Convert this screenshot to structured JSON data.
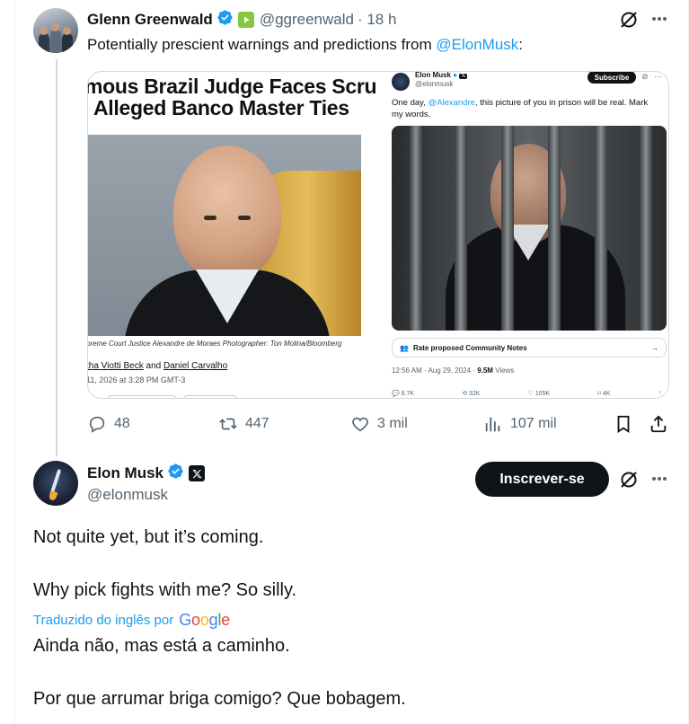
{
  "colors": {
    "accent": "#1d9bf0",
    "text": "#0f1419",
    "muted": "#536471",
    "subscribe_bg": "#0f1419"
  },
  "quoted_tweet": {
    "author": {
      "name": "Glenn Greenwald",
      "handle": "@ggreenwald",
      "time": "· 18 h",
      "verified": true,
      "badge_icon": "rumble-icon"
    },
    "text_before": "Potentially prescient warnings and predictions from ",
    "mention": "@ElonMusk",
    "text_after": ":",
    "media": {
      "article": {
        "headline_line1": "mous Brazil Judge Faces Scru",
        "headline_line2": "Alleged Banco Master Ties",
        "caption": "preme Court Justice Alexandre de Moraes Photographer: Ton Molina/Bloomberg",
        "byline_prefix": "tha Viotti Beck",
        "byline_and": " and ",
        "byline_author": "Daniel Carvalho",
        "date": "11, 2026 at 3:28 PM GMT-3"
      },
      "screenshot": {
        "name": "Elon Musk",
        "handle": "@elonmusk",
        "subscribe": "Subscribe",
        "text_prefix": "One day, ",
        "text_mention": "@Alexandre",
        "text_suffix": ", this picture of you in prison will be real. Mark my words.",
        "notes": "Rate proposed Community Notes",
        "meta_time": "12:56 AM · Aug 29, 2024 · ",
        "meta_views_num": "9.5M",
        "meta_views_label": " Views",
        "replies": "6.7K",
        "reposts": "32K",
        "likes": "105K",
        "bookmarks": "4K"
      }
    },
    "actions": {
      "replies": "48",
      "reposts": "447",
      "likes": "3 mil",
      "views": "107 mil"
    }
  },
  "main_tweet": {
    "author": {
      "name": "Elon Musk",
      "handle": "@elonmusk",
      "verified": true,
      "affiliate_icon": "x-logo-icon"
    },
    "subscribe_label": "Inscrever-se",
    "original_line1": "Not quite yet, but it’s coming.",
    "original_line2": "Why pick fights with me? So silly.",
    "translated_label": "Traduzido do inglês por",
    "translator": "Google",
    "translation_line1": "Ainda não, mas está a caminho.",
    "translation_line2": "Por que arrumar briga comigo? Que bobagem."
  }
}
